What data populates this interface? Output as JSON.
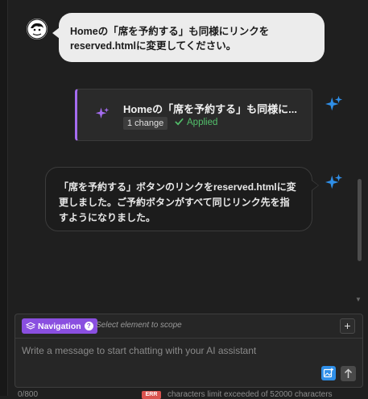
{
  "chat": {
    "user_message": "Homeの「席を予約する」も同様にリンクを reserved.htmlに変更してください。",
    "change_card": {
      "title": "Homeの「席を予約する」も同様に...",
      "count_label": "1 change",
      "status_label": "Applied"
    },
    "ai_message": "「席を予約する」ボタンのリンクをreserved.htmlに変更しました。ご予約ボタンがすべて同じリンク先を指すようになりました。"
  },
  "composer": {
    "scope_chip_label": "Navigation",
    "scope_hint": "Select element to scope",
    "add_label": "+",
    "placeholder": "Write a message to start chatting with your AI assistant"
  },
  "footer": {
    "char_count": "0/800",
    "badge": "ERR",
    "warning": "characters limit exceeded of 52000 characters"
  },
  "colors": {
    "accent_purple": "#8a4fe0",
    "applied_green": "#53c06b",
    "ai_blue": "#2f8fe8"
  },
  "icons": {
    "user_avatar": "avatar-icon",
    "ai_sparkle": "sparkle-icon",
    "change_sparkle": "sparkle-icon",
    "applied_check": "check-icon",
    "scope_layers": "layers-icon",
    "help": "help-icon",
    "image": "image-add-icon",
    "send": "arrow-up-icon"
  }
}
